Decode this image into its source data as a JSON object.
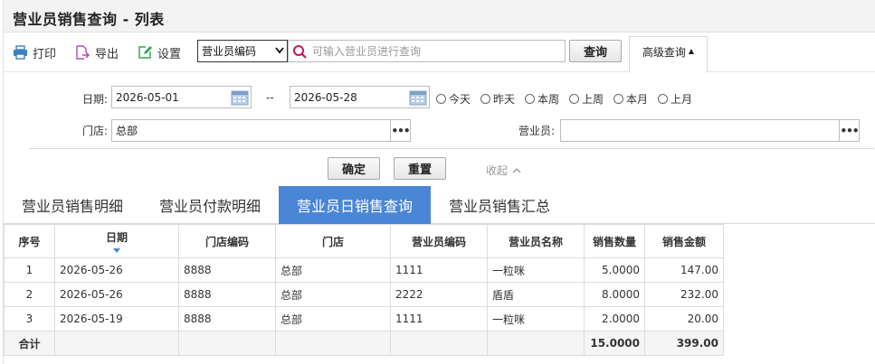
{
  "page": {
    "title": "营业员销售查询 - 列表"
  },
  "toolbar": {
    "print_label": "打印",
    "export_label": "导出",
    "settings_label": "设置",
    "search_field_selected": "营业员编码",
    "search_placeholder": "可输入营业员进行查询",
    "query_label": "查询",
    "advanced_label": "高级查询"
  },
  "filter": {
    "date_label": "日期:",
    "date_from": "2026-05-01",
    "date_sep": "--",
    "date_to": "2026-05-28",
    "store_label": "门店:",
    "store_value": "总部",
    "clerk_label": "营业员:",
    "clerk_value": "",
    "more_label": "•••",
    "ranges": [
      "今天",
      "昨天",
      "本周",
      "上周",
      "本月",
      "上月"
    ],
    "confirm_label": "确定",
    "reset_label": "重置",
    "collapse_label": "收起"
  },
  "tabs": [
    "营业员销售明细",
    "营业员付款明细",
    "营业员日销售查询",
    "营业员销售汇总"
  ],
  "active_tab": 2,
  "table": {
    "headers": [
      "序号",
      "日期",
      "门店编码",
      "门店",
      "营业员编码",
      "营业员名称",
      "销售数量",
      "销售金额"
    ],
    "rows": [
      [
        "1",
        "2026-05-26",
        "8888",
        "总部",
        "1111",
        "一粒咪",
        "5.0000",
        "147.00"
      ],
      [
        "2",
        "2026-05-26",
        "8888",
        "总部",
        "2222",
        "盾盾",
        "8.0000",
        "232.00"
      ],
      [
        "3",
        "2026-05-19",
        "8888",
        "总部",
        "1111",
        "一粒咪",
        "2.0000",
        "20.00"
      ]
    ],
    "total": {
      "label": "合计",
      "qty": "15.0000",
      "amount": "399.00"
    }
  },
  "colors": {
    "accent": "#4a86d6",
    "print_icon": "#3b7fc4",
    "export_icon": "#b04ab8",
    "settings_icon": "#3aa35c",
    "search_icon": "#c2185b"
  },
  "icons": {
    "print": "printer-icon",
    "export": "export-icon",
    "settings": "edit-icon",
    "search": "search-icon",
    "calendar": "calendar-icon"
  }
}
